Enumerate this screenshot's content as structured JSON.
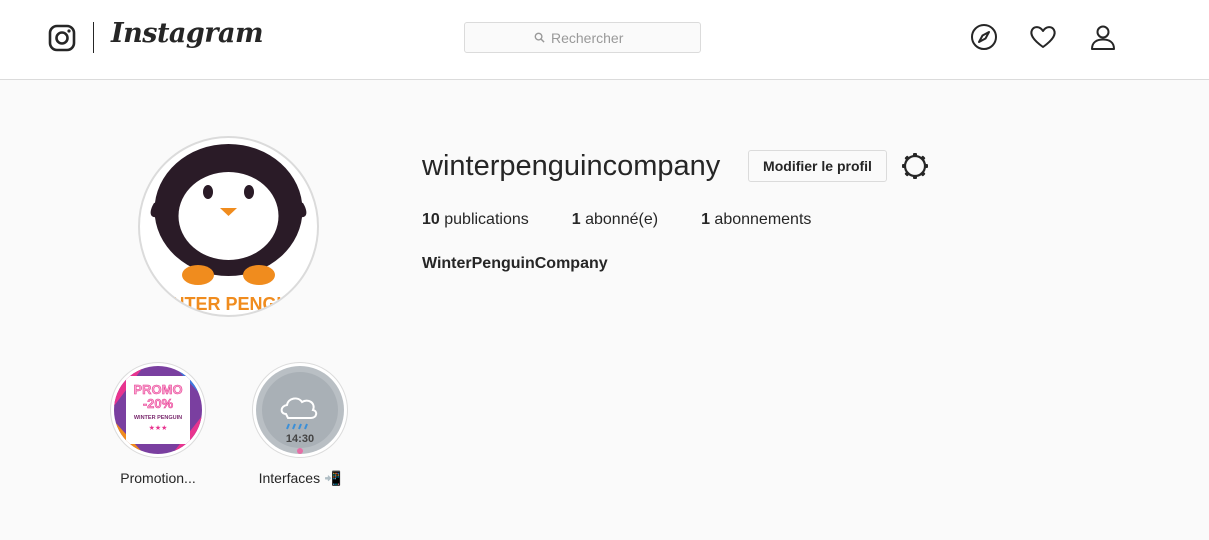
{
  "nav": {
    "logo_text": "Instagram",
    "search_placeholder": "Rechercher",
    "icons": [
      "instagram-glyph-icon",
      "compass-icon",
      "heart-icon",
      "profile-icon"
    ]
  },
  "profile": {
    "username": "winterpenguincompany",
    "edit_button": "Modifier le profil",
    "stats": {
      "posts_count": "10",
      "posts_label": "publications",
      "followers_count": "1",
      "followers_label": "abonné(e)",
      "following_count": "1",
      "following_label": "abonnements"
    },
    "full_name": "WinterPenguinCompany",
    "avatar_text": "WINTER PENGUIN"
  },
  "highlights": [
    {
      "label": "Promotion...",
      "cover_lines": [
        "PROMO",
        "-20%",
        "WINTER PENGUIN",
        "★★★"
      ]
    },
    {
      "label": "Interfaces 📲",
      "cover_time": "14:30"
    }
  ],
  "colors": {
    "accent_orange": "#f08c1e",
    "penguin_body": "#2a1b27",
    "promo_pink": "#e8348f"
  }
}
